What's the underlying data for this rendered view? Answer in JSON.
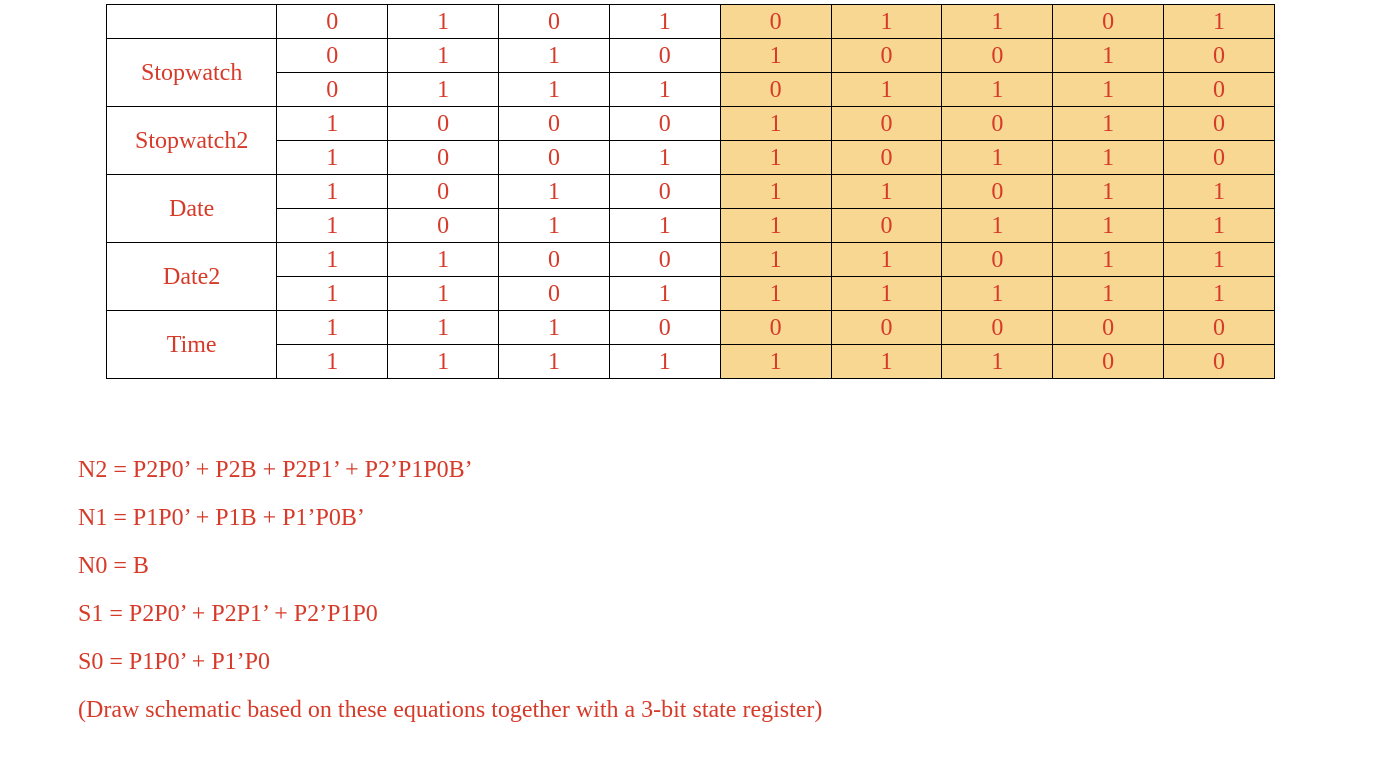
{
  "table": {
    "row_labels": [
      "",
      "Stopwatch",
      "Stopwatch2",
      "Date",
      "Date2",
      "Time"
    ],
    "row_spans": [
      1,
      2,
      2,
      2,
      2,
      2
    ],
    "rows": [
      [
        "0",
        "1",
        "0",
        "1",
        "0",
        "1",
        "1",
        "0",
        "1"
      ],
      [
        "0",
        "1",
        "1",
        "0",
        "1",
        "0",
        "0",
        "1",
        "0"
      ],
      [
        "0",
        "1",
        "1",
        "1",
        "0",
        "1",
        "1",
        "1",
        "0"
      ],
      [
        "1",
        "0",
        "0",
        "0",
        "1",
        "0",
        "0",
        "1",
        "0"
      ],
      [
        "1",
        "0",
        "0",
        "1",
        "1",
        "0",
        "1",
        "1",
        "0"
      ],
      [
        "1",
        "0",
        "1",
        "0",
        "1",
        "1",
        "0",
        "1",
        "1"
      ],
      [
        "1",
        "0",
        "1",
        "1",
        "1",
        "0",
        "1",
        "1",
        "1"
      ],
      [
        "1",
        "1",
        "0",
        "0",
        "1",
        "1",
        "0",
        "1",
        "1"
      ],
      [
        "1",
        "1",
        "0",
        "1",
        "1",
        "1",
        "1",
        "1",
        "1"
      ],
      [
        "1",
        "1",
        "1",
        "0",
        "0",
        "0",
        "0",
        "0",
        "0"
      ],
      [
        "1",
        "1",
        "1",
        "1",
        "1",
        "1",
        "1",
        "0",
        "0"
      ]
    ],
    "highlight_from_col": 4
  },
  "equations": [
    "N2 = P2P0’ + P2B + P2P1’ + P2’P1P0B’",
    "N1 = P1P0’ + P1B + P1’P0B’",
    "N0 = B",
    "S1 = P2P0’ + P2P1’ + P2’P1P0",
    "S0 = P1P0’ + P1’P0",
    "(Draw schematic based on these equations together with a 3-bit state register)"
  ]
}
